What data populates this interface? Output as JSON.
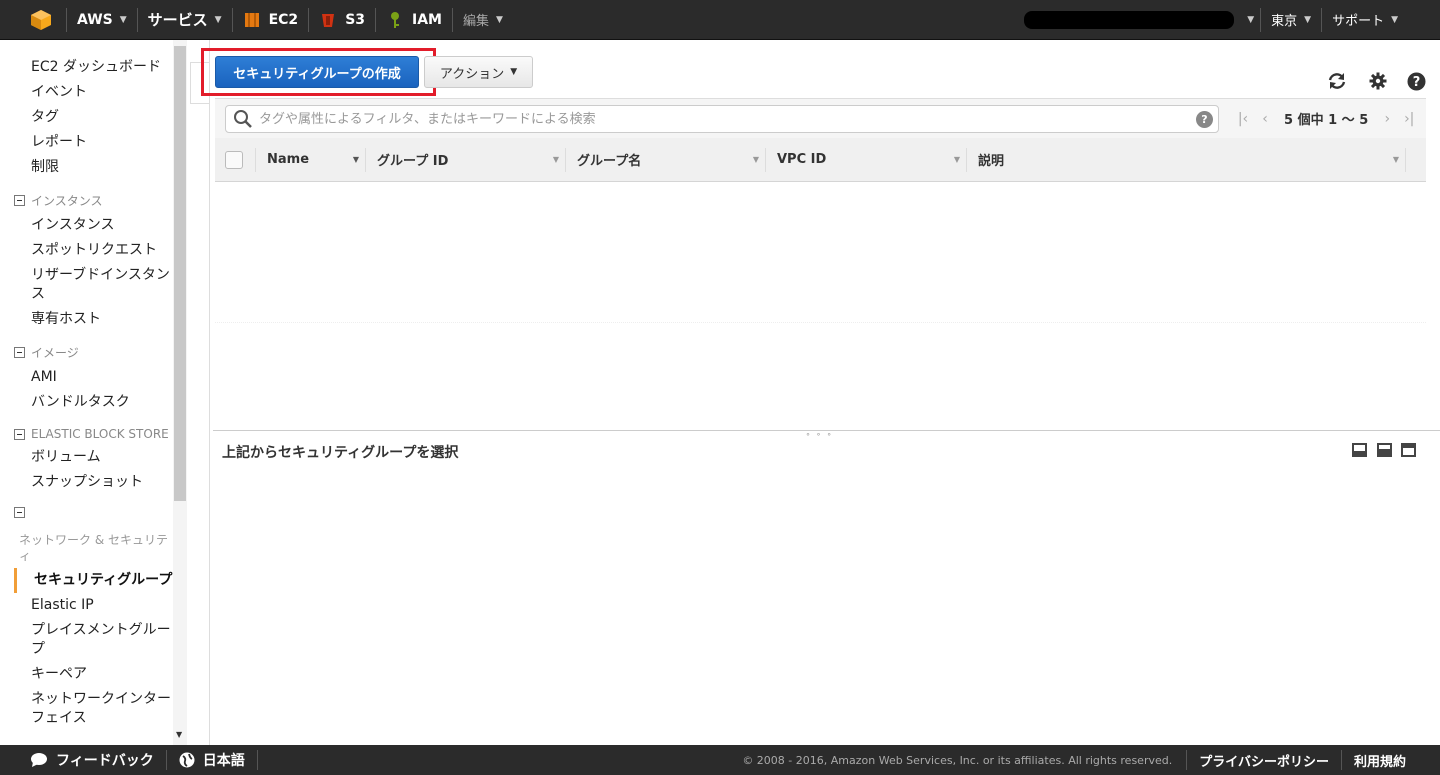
{
  "topbar": {
    "aws_label": "AWS",
    "services_label": "サービス",
    "ec2_label": "EC2",
    "s3_label": "S3",
    "iam_label": "IAM",
    "edit_label": "編集",
    "region_label": "東京",
    "support_label": "サポート"
  },
  "nav": {
    "top_items": [
      "EC2 ダッシュボード",
      "イベント",
      "タグ",
      "レポート",
      "制限"
    ],
    "sections": [
      {
        "title": "インスタンス",
        "items": [
          "インスタンス",
          "スポットリクエスト",
          "リザーブドインスタンス",
          "専有ホスト"
        ]
      },
      {
        "title": "イメージ",
        "items": [
          "AMI",
          "バンドルタスク"
        ]
      },
      {
        "title": "ELASTIC BLOCK STORE",
        "items": [
          "ボリューム",
          "スナップショット"
        ]
      }
    ],
    "network_section_title": "ネットワーク & セキュリティ",
    "network_items": [
      "セキュリティグループ",
      "Elastic IP",
      "プレイスメントグループ",
      "キーペア",
      "ネットワークインターフェイス"
    ],
    "active_item": "セキュリティグループ"
  },
  "toolbar": {
    "create_label": "セキュリティグループの作成",
    "actions_label": "アクション"
  },
  "filter": {
    "placeholder": "タグや属性によるフィルタ、またはキーワードによる検索",
    "help_glyph": "?",
    "pager_text": "5 個中 1 〜 5"
  },
  "table": {
    "columns": [
      "Name",
      "グループ ID",
      "グループ名",
      "VPC ID",
      "説明"
    ]
  },
  "details": {
    "title": "上記からセキュリティグループを選択"
  },
  "footer": {
    "feedback_label": "フィードバック",
    "language_label": "日本語",
    "copyright": "© 2008 - 2016, Amazon Web Services, Inc. or its affiliates. All rights reserved.",
    "privacy_label": "プライバシーポリシー",
    "terms_label": "利用規約"
  },
  "colors": {
    "topbar_bg": "#2b2b2b",
    "primary_button": "#1a63be",
    "highlight_box": "#e21c2a",
    "active_nav_accent": "#f19e38"
  }
}
